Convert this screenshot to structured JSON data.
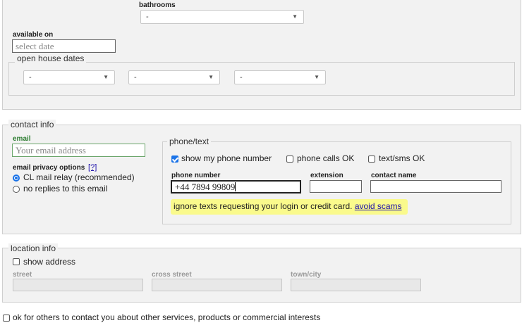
{
  "housing": {
    "bathrooms_label": "bathrooms",
    "bathrooms_value": "-",
    "available_on_label": "available on",
    "available_on_placeholder": "select date",
    "open_house_legend": "open house dates",
    "open_house_values": [
      "-",
      "-",
      "-"
    ]
  },
  "contact": {
    "legend": "contact info",
    "email_label": "email",
    "email_placeholder": "Your email address",
    "privacy_label": "email privacy options",
    "privacy_help": "[?]",
    "privacy_options": [
      "CL mail relay (recommended)",
      "no replies to this email"
    ],
    "phone_legend": "phone/text",
    "show_phone_label": "show my phone number",
    "phone_calls_label": "phone calls OK",
    "text_sms_label": "text/sms OK",
    "phone_number_label": "phone number",
    "phone_number_value": "+44 7894 99809",
    "extension_label": "extension",
    "contact_name_label": "contact name",
    "warning_text": "ignore texts requesting your login or credit card.",
    "warning_link": "avoid scams"
  },
  "location": {
    "legend": "location info",
    "show_address_label": "show address",
    "street_label": "street",
    "cross_street_label": "cross street",
    "city_label": "town/city"
  },
  "consent": {
    "label": "ok for others to contact you about other services, products or commercial interests"
  },
  "colors": {
    "accent": "#1a73e8",
    "warning_bg": "#fafa8c",
    "email_label": "#2e7d32",
    "email_border": "#6aa56a"
  },
  "icons": {
    "dropdown": "chevron-down-icon",
    "checkbox": "checkbox-icon",
    "radio": "radio-icon"
  }
}
